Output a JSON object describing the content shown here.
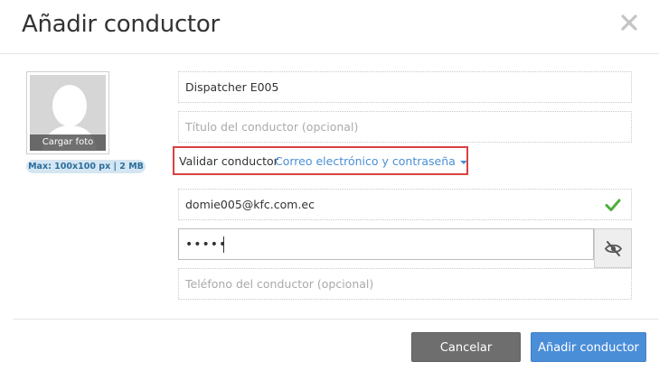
{
  "dialog": {
    "title": "Añadir conductor",
    "close_icon": "close-icon"
  },
  "photo": {
    "upload_label": "Cargar foto",
    "size_hint": "Max: 100x100 px | 2 MB"
  },
  "form": {
    "name_value": "Dispatcher E005",
    "title_placeholder": "Título del conductor (opcional)",
    "validate_label": "Validar conductor",
    "validate_method": "Correo electrónico y contraseña",
    "email_value": "domie005@kfc.com.ec",
    "password_value": "•••••",
    "phone_placeholder": "Teléfono del conductor (opcional)"
  },
  "buttons": {
    "cancel_label": "Cancelar",
    "add_label": "Añadir conductor"
  },
  "colors": {
    "accent": "#4b8ed8",
    "link": "#4a8fd6",
    "check": "#4caf3a",
    "highlight": "#d9423f"
  }
}
